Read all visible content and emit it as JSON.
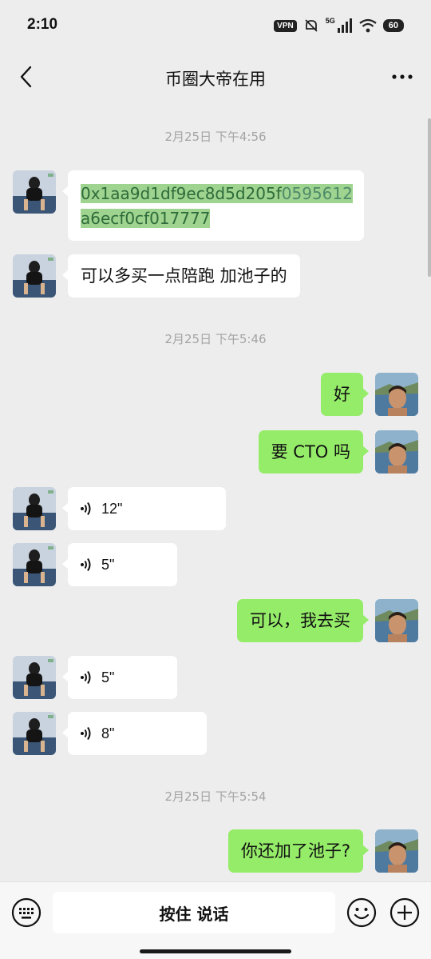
{
  "status_bar": {
    "time": "2:10",
    "vpn": "VPN",
    "network": "5G",
    "battery": "60"
  },
  "header": {
    "title": "币圈大帝在用",
    "back_icon": "chevron-left-icon",
    "more_icon": "more-dots-icon"
  },
  "messages": {
    "ts1": "2月25日 下午4:56",
    "m1_line1_a": "0x1aa9d1df9ec8d5d205f",
    "m1_line1_b": "0595612",
    "m1_line2": "a6ecf0cf017777",
    "m2": "可以多买一点陪跑 加池子的",
    "ts2": "2月25日 下午5:46",
    "m3": "好",
    "m4": "要 CTO 吗",
    "m5": "12\"",
    "m6": "5\"",
    "m7": "可以，我去买",
    "m8": "5\"",
    "m9": "8\"",
    "ts3": "2月25日 下午5:54",
    "m10": "你还加了池子?"
  },
  "input_bar": {
    "hold_to_talk": "按住 说话",
    "keyboard_icon": "keyboard-icon",
    "emoji_icon": "emoji-icon",
    "plus_icon": "plus-circle-icon"
  },
  "colors": {
    "background": "#ededed",
    "incoming_bubble": "#ffffff",
    "outgoing_bubble": "#95ec69",
    "timestamp": "#a4a4a4",
    "highlight": "#9ed48f"
  }
}
